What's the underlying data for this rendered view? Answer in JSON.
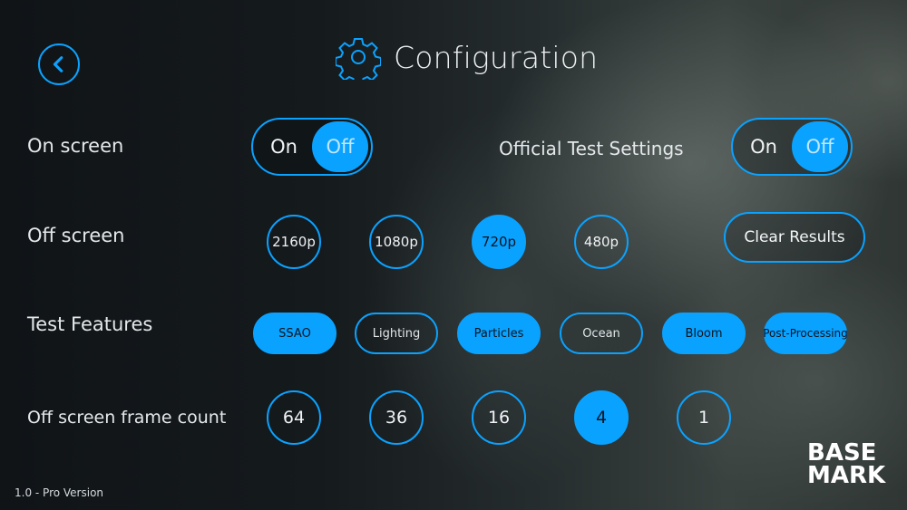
{
  "header": {
    "title": "Configuration"
  },
  "colors": {
    "accent": "#0aa2ff"
  },
  "icons": {
    "back": "chevron-left-icon",
    "settings": "gear-icon"
  },
  "settings": {
    "on_screen": {
      "label": "On screen",
      "options": [
        "On",
        "Off"
      ],
      "selected": "Off"
    },
    "official_test_settings": {
      "label": "Official Test Settings",
      "options": [
        "On",
        "Off"
      ],
      "selected": "Off"
    },
    "off_screen": {
      "label": "Off screen",
      "resolutions": [
        "2160p",
        "1080p",
        "720p",
        "480p"
      ],
      "selected": "720p"
    },
    "clear_results": {
      "label": "Clear Results"
    },
    "test_features": {
      "label": "Test Features",
      "items": [
        {
          "label": "SSAO",
          "enabled": true
        },
        {
          "label": "Lighting",
          "enabled": false
        },
        {
          "label": "Particles",
          "enabled": true
        },
        {
          "label": "Ocean",
          "enabled": false
        },
        {
          "label": "Bloom",
          "enabled": true
        },
        {
          "label": "Post-Processing",
          "enabled": true
        }
      ]
    },
    "frame_count": {
      "label": "Off screen frame count",
      "options": [
        "64",
        "36",
        "16",
        "4",
        "1"
      ],
      "selected": "4"
    }
  },
  "footer": {
    "version": "1.0 - Pro Version"
  },
  "logo": {
    "line1": "BASE",
    "line2": "MARK"
  }
}
